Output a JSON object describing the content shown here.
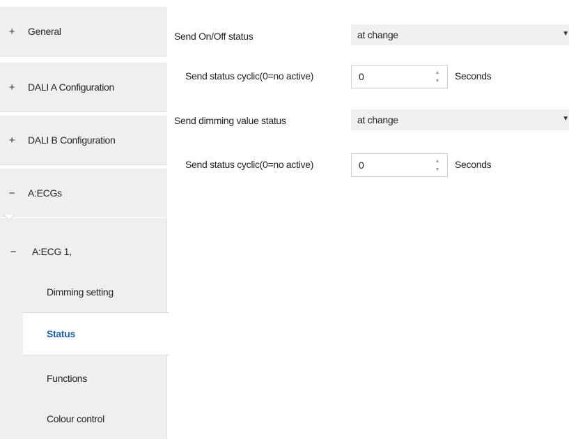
{
  "sidebar": {
    "items": [
      {
        "sign": "+",
        "label": "General"
      },
      {
        "sign": "+",
        "label": "DALI A Configuration"
      },
      {
        "sign": "+",
        "label": "DALI B Configuration"
      },
      {
        "sign": "−",
        "label": "A:ECGs"
      }
    ],
    "group": {
      "sign": "−",
      "label": "A:ECG 1,"
    },
    "children": [
      {
        "label": "Dimming setting"
      },
      {
        "label": "Status"
      },
      {
        "label": "Functions"
      },
      {
        "label": "Colour control"
      }
    ],
    "active_child": "Status"
  },
  "main": {
    "rows": [
      {
        "label": "Send On/Off status",
        "value": "at change",
        "type": "select"
      },
      {
        "label": "Send status cyclic(0=no active)",
        "value": "0",
        "unit": "Seconds",
        "type": "spin"
      },
      {
        "label": "Send dimming value status",
        "value": "at change",
        "type": "select"
      },
      {
        "label": "Send status cyclic(0=no active)",
        "value": "0",
        "unit": "Seconds",
        "type": "spin"
      }
    ]
  },
  "icons": {
    "dropdown": "chevron-down-icon",
    "spin_up": "spin-up-icon",
    "spin_down": "spin-down-icon"
  },
  "colors": {
    "sidebar_bg": "#efefef",
    "active_text": "#1f5fa8",
    "select_bg": "#f0f0f0"
  }
}
